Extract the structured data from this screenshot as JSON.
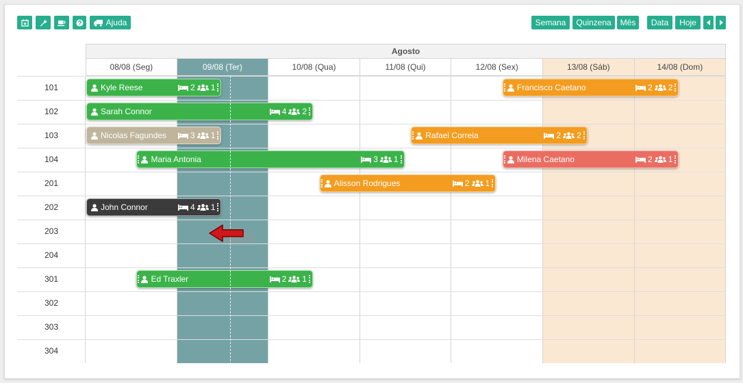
{
  "toolbar": {
    "left": [
      {
        "name": "calendar-add-button",
        "icon": "calendar-plus-icon",
        "label": ""
      },
      {
        "name": "settings-button",
        "icon": "wrench-icon",
        "label": ""
      },
      {
        "name": "coffee-button",
        "icon": "coffee-icon",
        "label": ""
      },
      {
        "name": "help-button",
        "icon": "question-icon",
        "label": ""
      },
      {
        "name": "ajuda-button",
        "icon": "truck-icon",
        "label": "Ajuda"
      }
    ],
    "right": [
      {
        "name": "semana-button",
        "label": "Semana"
      },
      {
        "name": "quinzena-button",
        "label": "Quinzena"
      },
      {
        "name": "mes-button",
        "label": "Mês"
      },
      {
        "name": "data-button",
        "label": "Data"
      },
      {
        "name": "hoje-button",
        "label": "Hoje"
      },
      {
        "name": "prev-button",
        "icon": "caret-left-icon",
        "label": ""
      },
      {
        "name": "next-button",
        "icon": "caret-right-icon",
        "label": ""
      }
    ]
  },
  "calendar": {
    "month": "Agosto",
    "days": [
      {
        "label": "08/08 (Seg)",
        "type": "normal"
      },
      {
        "label": "09/08 (Ter)",
        "type": "today"
      },
      {
        "label": "10/08 (Qua)",
        "type": "normal"
      },
      {
        "label": "11/08 (Qui)",
        "type": "normal"
      },
      {
        "label": "12/08 (Sex)",
        "type": "normal"
      },
      {
        "label": "13/08 (Sáb)",
        "type": "weekend"
      },
      {
        "label": "14/08 (Dom)",
        "type": "weekend"
      }
    ],
    "rooms": [
      "101",
      "102",
      "103",
      "104",
      "201",
      "202",
      "203",
      "204",
      "301",
      "302",
      "303",
      "304"
    ],
    "colors": {
      "green": "#3bb34a",
      "orange": "#f39c1f",
      "gray": "#bfb59c",
      "red": "#ea6d62",
      "dark": "#3b3b3b",
      "today": "#75a3a5",
      "weekend": "#fbe8d3",
      "accent": "#27ae8e"
    },
    "reservations": [
      {
        "guest": "Kyle Reese",
        "room": 0,
        "start": 0,
        "end": 1.5,
        "beds": "2",
        "people": "1",
        "color": "green",
        "lhandle": false,
        "rhandle": true
      },
      {
        "guest": "Sarah Connor",
        "room": 1,
        "start": 0,
        "end": 2.5,
        "beds": "4",
        "people": "2",
        "color": "green",
        "lhandle": false,
        "rhandle": true
      },
      {
        "guest": "Nicolas Fagundes",
        "room": 2,
        "start": 0,
        "end": 1.5,
        "beds": "3",
        "people": "1",
        "color": "gray",
        "lhandle": false,
        "rhandle": true
      },
      {
        "guest": "Maria Antonia",
        "room": 3,
        "start": 0.55,
        "end": 3.5,
        "beds": "3",
        "people": "1",
        "color": "green",
        "lhandle": true,
        "rhandle": true
      },
      {
        "guest": "John Connor",
        "room": 5,
        "start": 0,
        "end": 1.5,
        "beds": "4",
        "people": "1",
        "color": "dark",
        "lhandle": false,
        "rhandle": true
      },
      {
        "guest": "Ed Traxler",
        "room": 8,
        "start": 0.55,
        "end": 2.5,
        "beds": "2",
        "people": "1",
        "color": "green",
        "lhandle": true,
        "rhandle": true
      },
      {
        "guest": "Francisco Caetano",
        "room": 0,
        "start": 4.55,
        "end": 6.5,
        "beds": "2",
        "people": "2",
        "color": "orange",
        "lhandle": true,
        "rhandle": true
      },
      {
        "guest": "Rafael Correia",
        "room": 2,
        "start": 3.55,
        "end": 5.5,
        "beds": "2",
        "people": "2",
        "color": "orange",
        "lhandle": true,
        "rhandle": true
      },
      {
        "guest": "Milena Caetano",
        "room": 3,
        "start": 4.55,
        "end": 6.5,
        "beds": "2",
        "people": "1",
        "color": "red",
        "lhandle": true,
        "rhandle": true
      },
      {
        "guest": "Alisson Rodrigues",
        "room": 4,
        "start": 2.55,
        "end": 4.5,
        "beds": "2",
        "people": "1",
        "color": "orange",
        "lhandle": true,
        "rhandle": true
      }
    ]
  }
}
